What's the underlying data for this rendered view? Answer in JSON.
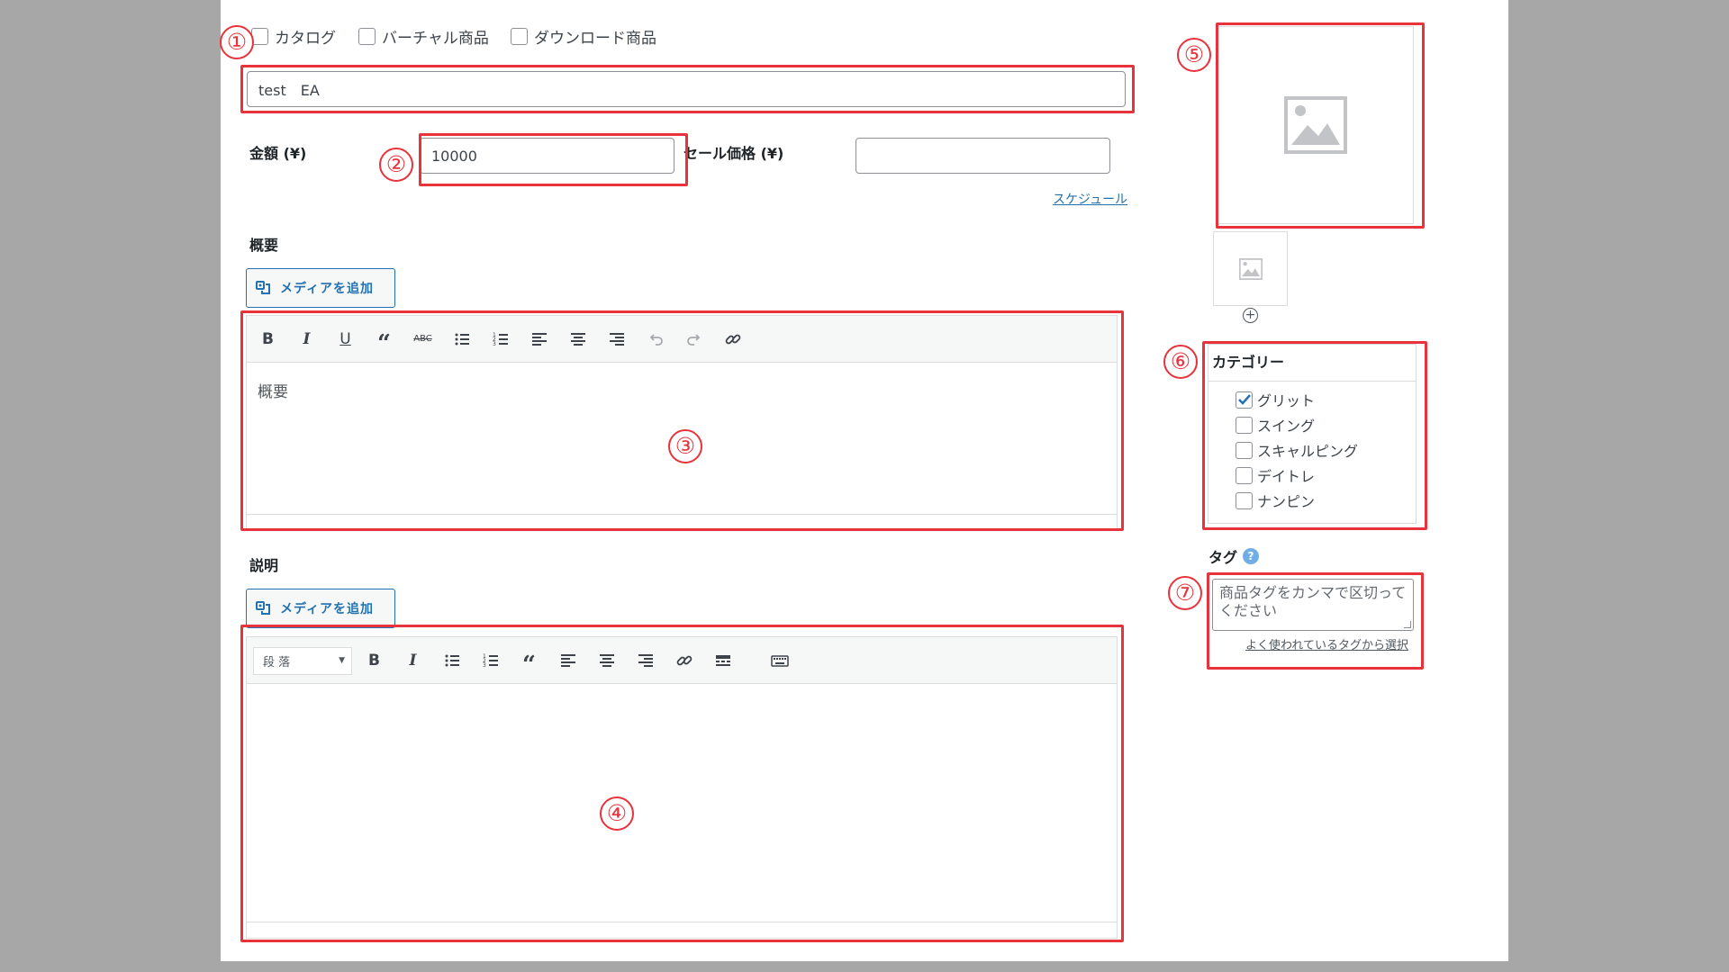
{
  "product_type": {
    "options": [
      {
        "label": "カタログ",
        "checked": false
      },
      {
        "label": "バーチャル商品",
        "checked": false
      },
      {
        "label": "ダウンロード商品",
        "checked": false
      }
    ]
  },
  "title": {
    "value": "test　EA"
  },
  "price": {
    "regular_label": "金額 (¥)",
    "regular_value": "10000",
    "sale_label": "セール価格 (¥)",
    "sale_value": "",
    "schedule_link": "スケジュール"
  },
  "summary": {
    "section_label": "概要",
    "media_button": "メディアを追加",
    "content": "概要"
  },
  "description": {
    "section_label": "説明",
    "media_button": "メディアを追加",
    "format_select": "段 落",
    "content": ""
  },
  "categories": {
    "title": "カテゴリー",
    "items": [
      {
        "label": "グリット",
        "checked": true
      },
      {
        "label": "スイング",
        "checked": false
      },
      {
        "label": "スキャルピング",
        "checked": false
      },
      {
        "label": "デイトレ",
        "checked": false
      },
      {
        "label": "ナンピン",
        "checked": false
      }
    ]
  },
  "tags": {
    "title": "タグ",
    "placeholder": "商品タグをカンマで区切ってください",
    "popular_link": "よく使われているタグから選択"
  },
  "annotations": [
    "①",
    "②",
    "③",
    "④",
    "⑤",
    "⑥",
    "⑦"
  ],
  "colors": {
    "annotation_red": "#e8323c",
    "wp_blue": "#2271b1",
    "outer_background": "#a7a7a7"
  }
}
